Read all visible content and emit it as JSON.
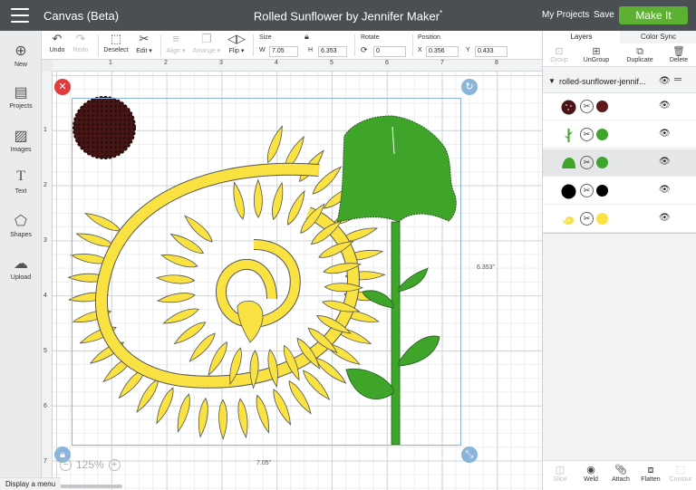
{
  "topbar": {
    "app_title": "Canvas (Beta)",
    "doc_title": "Rolled Sunflower by Jennifer Maker",
    "unsaved_mark": "*",
    "my_projects": "My Projects",
    "save": "Save",
    "make_it": "Make It"
  },
  "toolbar": {
    "undo": "Undo",
    "redo": "Redo",
    "deselect": "Deselect",
    "edit": "Edit",
    "align": "Align",
    "arrange": "Arrange",
    "flip": "Flip",
    "size_label": "Size",
    "w_label": "W",
    "w_value": "7.05",
    "h_label": "H",
    "h_value": "6.353",
    "rotate_label": "Rotate",
    "rotate_value": "0",
    "position_label": "Position",
    "x_label": "X",
    "x_value": "0.356",
    "y_label": "Y",
    "y_value": "0.433"
  },
  "sidebar": {
    "items": [
      {
        "label": "New",
        "icon": "plus-circle-icon"
      },
      {
        "label": "Projects",
        "icon": "book-icon"
      },
      {
        "label": "Images",
        "icon": "image-icon"
      },
      {
        "label": "Text",
        "icon": "text-t-icon"
      },
      {
        "label": "Shapes",
        "icon": "shapes-icon"
      },
      {
        "label": "Upload",
        "icon": "upload-cloud-icon"
      }
    ]
  },
  "ruler": {
    "h": [
      "1",
      "2",
      "3",
      "4",
      "5",
      "6",
      "7",
      "8"
    ],
    "v": [
      "1",
      "2",
      "3",
      "4",
      "5",
      "6",
      "7"
    ]
  },
  "canvas": {
    "width_label": "7.05\"",
    "height_label": "6.353\"",
    "zoom": "125%"
  },
  "panel": {
    "tabs": [
      "Layers",
      "Color Sync"
    ],
    "tools": {
      "group": "Group",
      "ungroup": "UnGroup",
      "duplicate": "Duplicate",
      "delete": "Delete"
    },
    "group_name": "rolled-sunflower-jennif...",
    "layers": [
      {
        "thumb": "#4a1414",
        "color": "#5c1a1a",
        "icon": "dots-thumb-icon"
      },
      {
        "thumb": "#3ea52a",
        "color": "#3ea52a",
        "icon": "stem-thumb-icon"
      },
      {
        "thumb": "#3ea52a",
        "color": "#3ea52a",
        "icon": "leaf-thumb-icon"
      },
      {
        "thumb": "#000000",
        "color": "#000000",
        "icon": "black-blob-thumb-icon"
      },
      {
        "thumb": "#f9e242",
        "color": "#f9e242",
        "icon": "spiral-thumb-icon"
      }
    ],
    "bottom": {
      "slice": "Slice",
      "weld": "Weld",
      "attach": "Attach",
      "flatten": "Flatten",
      "contour": "Contour"
    }
  },
  "status": "Display a menu",
  "colors": {
    "topbar": "#4a4f54",
    "accent": "#5cb032",
    "petal": "#f9e242",
    "leaf": "#3ea52a",
    "center": "#4a1414",
    "selection": "#8ab4d9"
  }
}
